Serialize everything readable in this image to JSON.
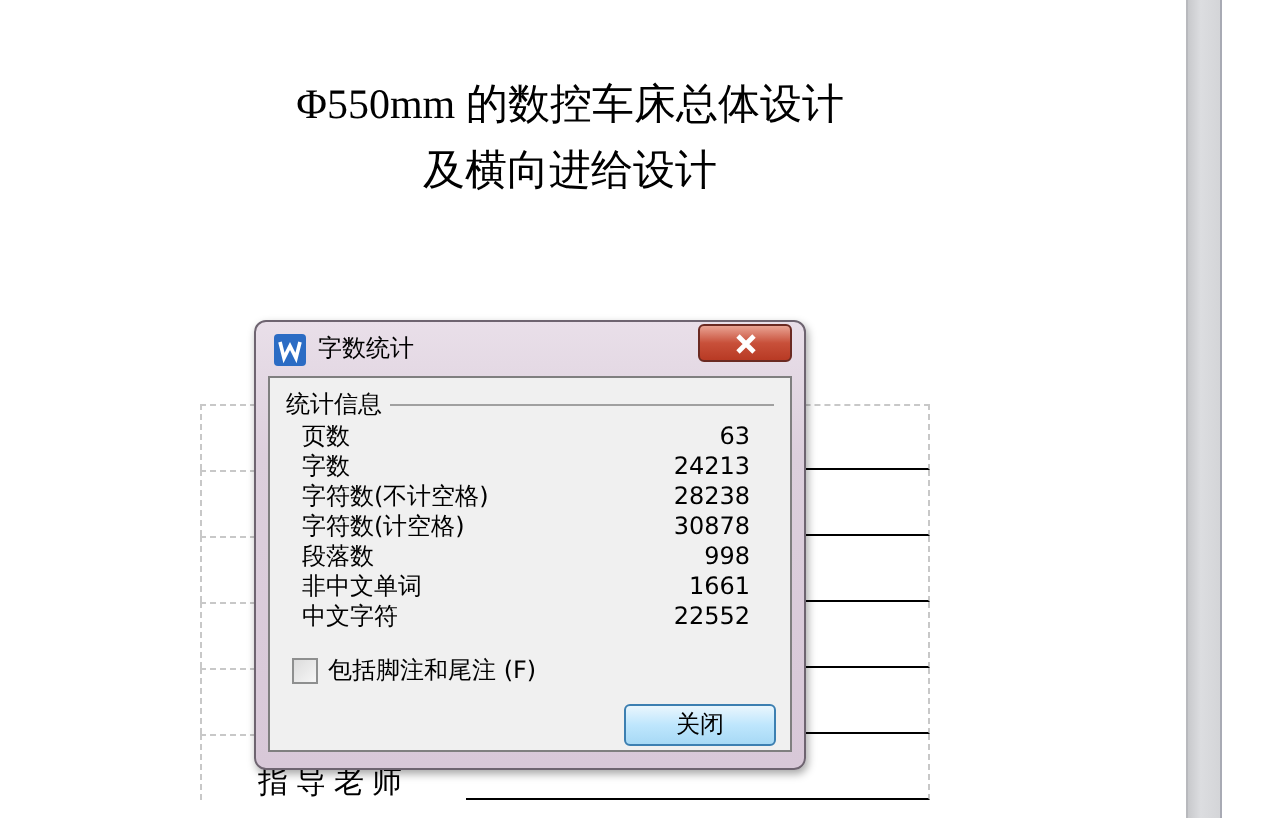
{
  "document": {
    "title_lines": [
      "Φ550mm 的数控车床总体设计",
      "及横向进给设计"
    ],
    "table": {
      "last_row_label": "指导老师"
    }
  },
  "dialog": {
    "title": "字数统计",
    "section": "统计信息",
    "stats": [
      {
        "label": "页数",
        "value": "63"
      },
      {
        "label": "字数",
        "value": "24213"
      },
      {
        "label": "字符数(不计空格)",
        "value": "28238"
      },
      {
        "label": "字符数(计空格)",
        "value": "30878"
      },
      {
        "label": "段落数",
        "value": "998"
      },
      {
        "label": "非中文单词",
        "value": "1661"
      },
      {
        "label": "中文字符",
        "value": "22552"
      }
    ],
    "checkbox": {
      "label": "包括脚注和尾注 (F)",
      "checked": false
    },
    "close_button": "关闭"
  }
}
